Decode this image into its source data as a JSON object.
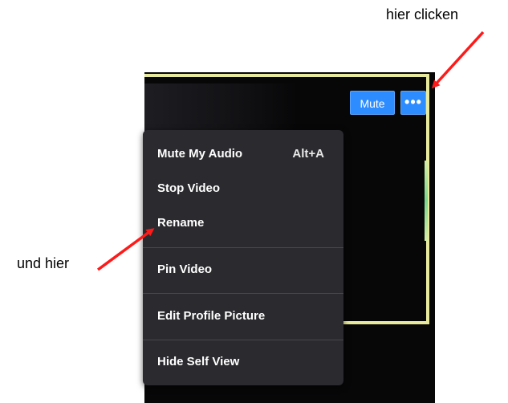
{
  "video_tile": {
    "mute_button_label": "Mute",
    "more_button_label": "•••"
  },
  "context_menu": {
    "items": [
      {
        "label": "Mute My Audio",
        "shortcut": "Alt+A"
      },
      {
        "label": "Stop Video"
      },
      {
        "label": "Rename"
      },
      {
        "label": "Pin Video"
      },
      {
        "label": "Edit Profile Picture"
      },
      {
        "label": "Hide Self View"
      }
    ]
  },
  "annotations": {
    "top_label": "hier clicken",
    "left_label": "und hier",
    "arrow_color": "#ff1a1a"
  },
  "colors": {
    "button_blue": "#2d8cff",
    "menu_bg": "#2b2b2f",
    "active_speaker_frame": "#e7ea9c"
  }
}
